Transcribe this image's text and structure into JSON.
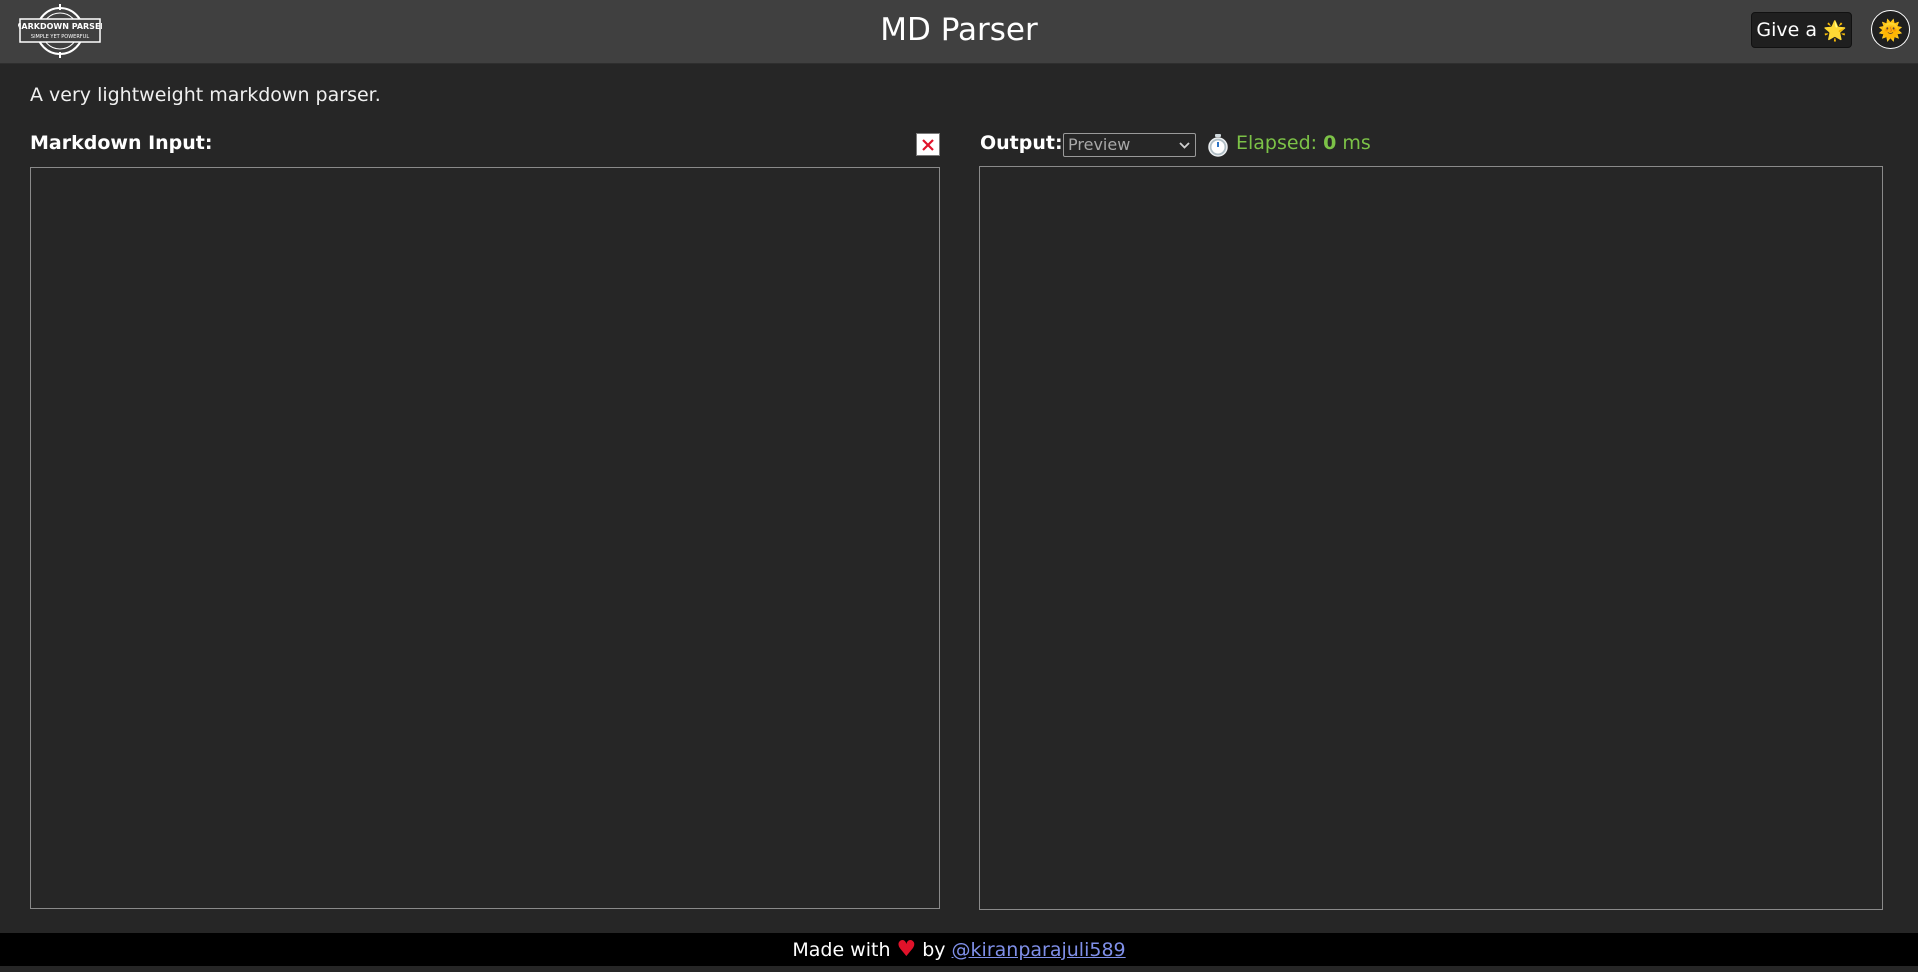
{
  "header": {
    "logo": {
      "line1": "MARKDOWN PARSER",
      "line2": "SIMPLE YET POWERFUL"
    },
    "title": "MD Parser",
    "star_button": {
      "label": "Give a",
      "emoji": "🌟"
    },
    "theme_toggle": {
      "icon": "sun-icon",
      "emoji": "🌞"
    }
  },
  "tagline": "A very lightweight markdown parser.",
  "input_panel": {
    "label": "Markdown Input:",
    "value": "",
    "clear_icon": "close-icon",
    "clear_color": "#e0122a"
  },
  "output_panel": {
    "label": "Output:",
    "mode_selected": "Preview",
    "elapsed_label": "Elapsed:",
    "elapsed_value": "0",
    "elapsed_unit": "ms",
    "elapsed_color": "#7cc247"
  },
  "footer": {
    "made_with": "Made with",
    "heart": "♥",
    "by": "by",
    "author": "@kiranparajuli589"
  },
  "colors": {
    "background": "#262626",
    "header": "#404040",
    "footer": "#000000",
    "link": "#7f8fe8"
  }
}
